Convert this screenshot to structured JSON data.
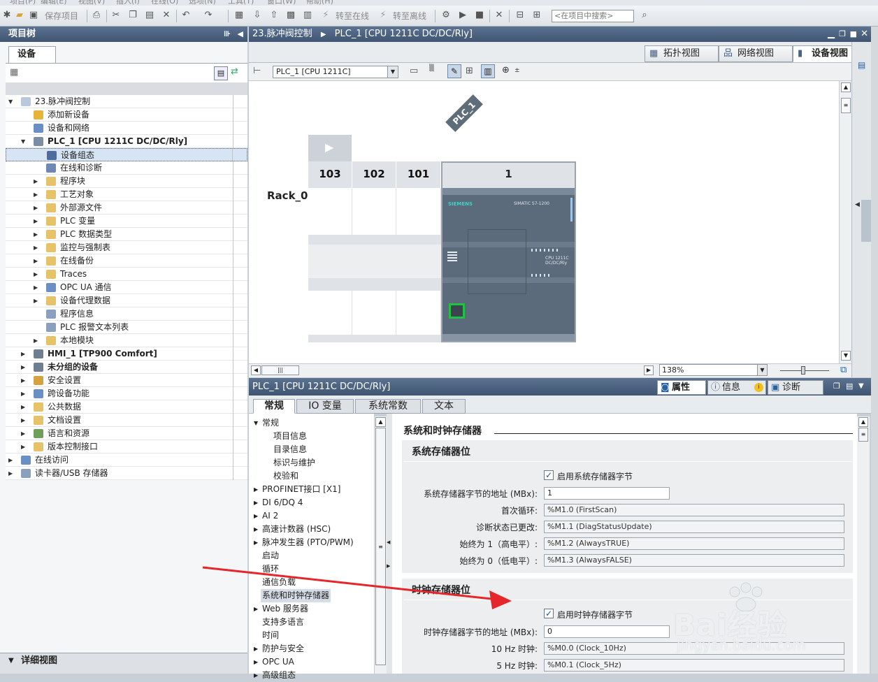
{
  "menubar": {
    "items": [
      "项目(P)",
      "编辑(E)",
      "视图(V)",
      "插入(I)",
      "在线(O)",
      "选项(N)",
      "工具(T)",
      "窗口(W)",
      "帮助(H)"
    ]
  },
  "toolbar": {
    "save_project": "保存项目",
    "go_online": "转至在线",
    "go_offline": "转至离线",
    "search_placeholder": "<在项目中搜索>"
  },
  "left_panel": {
    "title": "项目树",
    "devices_tab": "设备",
    "tree": [
      {
        "label": "23.脉冲阀控制",
        "level": 0,
        "expanded": true,
        "icon": "project-icon",
        "color": "#b9c8dd"
      },
      {
        "label": "添加新设备",
        "level": 1,
        "icon": "add-device-icon",
        "color": "#e7b43a"
      },
      {
        "label": "设备和网络",
        "level": 1,
        "icon": "network-icon",
        "color": "#6a8fc5"
      },
      {
        "label": "PLC_1 [CPU 1211C DC/DC/Rly]",
        "level": 1,
        "expanded": true,
        "icon": "plc-icon",
        "color": "#7a8da3",
        "bold": true
      },
      {
        "label": "设备组态",
        "level": 2,
        "icon": "device-config-icon",
        "color": "#4c6e9f",
        "selected": true
      },
      {
        "label": "在线和诊断",
        "level": 2,
        "icon": "diagnostics-icon",
        "color": "#6c88b3"
      },
      {
        "label": "程序块",
        "level": 2,
        "collapsed": true,
        "icon": "folder-icon",
        "color": "#e6c269"
      },
      {
        "label": "工艺对象",
        "level": 2,
        "collapsed": true,
        "icon": "folder-icon",
        "color": "#e6c269"
      },
      {
        "label": "外部源文件",
        "level": 2,
        "collapsed": true,
        "icon": "folder-icon",
        "color": "#e6c269"
      },
      {
        "label": "PLC 变量",
        "level": 2,
        "collapsed": true,
        "icon": "folder-icon",
        "color": "#e6c269"
      },
      {
        "label": "PLC 数据类型",
        "level": 2,
        "collapsed": true,
        "icon": "folder-icon",
        "color": "#e6c269"
      },
      {
        "label": "监控与强制表",
        "level": 2,
        "collapsed": true,
        "icon": "folder-icon",
        "color": "#e6c269"
      },
      {
        "label": "在线备份",
        "level": 2,
        "collapsed": true,
        "icon": "folder-icon",
        "color": "#e6c269"
      },
      {
        "label": "Traces",
        "level": 2,
        "collapsed": true,
        "icon": "folder-icon",
        "color": "#e6c269"
      },
      {
        "label": "OPC UA 通信",
        "level": 2,
        "collapsed": true,
        "icon": "opc-icon",
        "color": "#6a8fc5"
      },
      {
        "label": "设备代理数据",
        "level": 2,
        "collapsed": true,
        "icon": "folder-icon",
        "color": "#e6c269"
      },
      {
        "label": "程序信息",
        "level": 2,
        "icon": "info-icon",
        "color": "#8aa0bd"
      },
      {
        "label": "PLC 报警文本列表",
        "level": 2,
        "icon": "list-icon",
        "color": "#8aa0bd"
      },
      {
        "label": "本地模块",
        "level": 2,
        "collapsed": true,
        "icon": "folder-icon",
        "color": "#e6c269"
      },
      {
        "label": "HMI_1 [TP900 Comfort]",
        "level": 1,
        "collapsed": true,
        "icon": "hmi-icon",
        "color": "#6f7e90",
        "bold": true
      },
      {
        "label": "未分组的设备",
        "level": 1,
        "collapsed": true,
        "icon": "devices-icon",
        "color": "#6f7e90",
        "bold": true
      },
      {
        "label": "安全设置",
        "level": 1,
        "collapsed": true,
        "icon": "security-icon",
        "color": "#d6a23f"
      },
      {
        "label": "跨设备功能",
        "level": 1,
        "collapsed": true,
        "icon": "cross-device-icon",
        "color": "#6a8fc5"
      },
      {
        "label": "公共数据",
        "level": 1,
        "collapsed": true,
        "icon": "folder-icon",
        "color": "#e6c269"
      },
      {
        "label": "文档设置",
        "level": 1,
        "collapsed": true,
        "icon": "folder-icon",
        "color": "#e6c269"
      },
      {
        "label": "语言和资源",
        "level": 1,
        "collapsed": true,
        "icon": "language-icon",
        "color": "#6fa05a"
      },
      {
        "label": "版本控制接口",
        "level": 1,
        "collapsed": true,
        "icon": "folder-icon",
        "color": "#e6c269"
      },
      {
        "label": "在线访问",
        "level": 0,
        "collapsed": true,
        "icon": "online-icon",
        "color": "#6a8fc5"
      },
      {
        "label": "读卡器/USB 存储器",
        "level": 0,
        "collapsed": true,
        "icon": "usb-icon",
        "color": "#8aa0bd"
      }
    ],
    "detail_view": "详细视图"
  },
  "center": {
    "breadcrumb_project": "23.脉冲阀控制",
    "breadcrumb_device": "PLC_1 [CPU 1211C DC/DC/Rly]",
    "view_tabs": [
      "拓扑视图",
      "网络视图",
      "设备视图"
    ],
    "device_select": "PLC_1 [CPU 1211C]",
    "plc_badge": "PLC_1",
    "rack_label": "Rack_0",
    "slots": [
      "103",
      "102",
      "101",
      "1"
    ],
    "plc_brand": "SIEMENS",
    "plc_model_text": "SIMATIC S7-1200",
    "plc_cpu_text": "CPU 1211C DC/DC/Rly",
    "zoom": "138%"
  },
  "properties": {
    "title": "PLC_1 [CPU 1211C DC/DC/Rly]",
    "top_tabs": [
      "属性",
      "信息",
      "诊断"
    ],
    "tabs": [
      "常规",
      "IO 变量",
      "系统常数",
      "文本"
    ],
    "nav": [
      {
        "label": "常规",
        "type": "parent-open"
      },
      {
        "label": "项目信息",
        "type": "child"
      },
      {
        "label": "目录信息",
        "type": "child"
      },
      {
        "label": "标识与维护",
        "type": "child"
      },
      {
        "label": "校验和",
        "type": "child"
      },
      {
        "label": "PROFINET接口 [X1]",
        "type": "parent"
      },
      {
        "label": "DI 6/DQ 4",
        "type": "parent"
      },
      {
        "label": "AI 2",
        "type": "parent"
      },
      {
        "label": "高速计数器 (HSC)",
        "type": "parent"
      },
      {
        "label": "脉冲发生器 (PTO/PWM)",
        "type": "parent"
      },
      {
        "label": "启动",
        "type": "item"
      },
      {
        "label": "循环",
        "type": "item"
      },
      {
        "label": "通信负载",
        "type": "item"
      },
      {
        "label": "系统和时钟存储器",
        "type": "selected"
      },
      {
        "label": "Web 服务器",
        "type": "parent"
      },
      {
        "label": "支持多语言",
        "type": "item"
      },
      {
        "label": "时间",
        "type": "item"
      },
      {
        "label": "防护与安全",
        "type": "parent"
      },
      {
        "label": "OPC UA",
        "type": "parent"
      },
      {
        "label": "高级组态",
        "type": "parent"
      }
    ],
    "content": {
      "header": "系统和时钟存储器",
      "sys_section": "系统存储器位",
      "sys_enable": "启用系统存储器字节",
      "sys_addr_label": "系统存储器字节的地址 (MBx):",
      "sys_addr_value": "1",
      "sys_fields": [
        {
          "label": "首次循环:",
          "value": "%M1.0 (FirstScan)"
        },
        {
          "label": "诊断状态已更改:",
          "value": "%M1.1 (DiagStatusUpdate)"
        },
        {
          "label": "始终为 1（高电平）:",
          "value": "%M1.2 (AlwaysTRUE)"
        },
        {
          "label": "始终为 0（低电平）:",
          "value": "%M1.3 (AlwaysFALSE)"
        }
      ],
      "clk_section": "时钟存储器位",
      "clk_enable": "启用时钟存储器字节",
      "clk_addr_label": "时钟存储器字节的地址 (MBx):",
      "clk_addr_value": "0",
      "clk_fields": [
        {
          "label": "10 Hz 时钟:",
          "value": "%M0.0 (Clock_10Hz)"
        },
        {
          "label": "5 Hz 时钟:",
          "value": "%M0.1 (Clock_5Hz)"
        }
      ]
    }
  },
  "watermark": {
    "text": "Bai经验",
    "url": "jingyan.baidu.com"
  },
  "colors": {
    "title_bar": "#4a617f",
    "arrow": "#e5262a",
    "selection": "#d6e4f3"
  }
}
